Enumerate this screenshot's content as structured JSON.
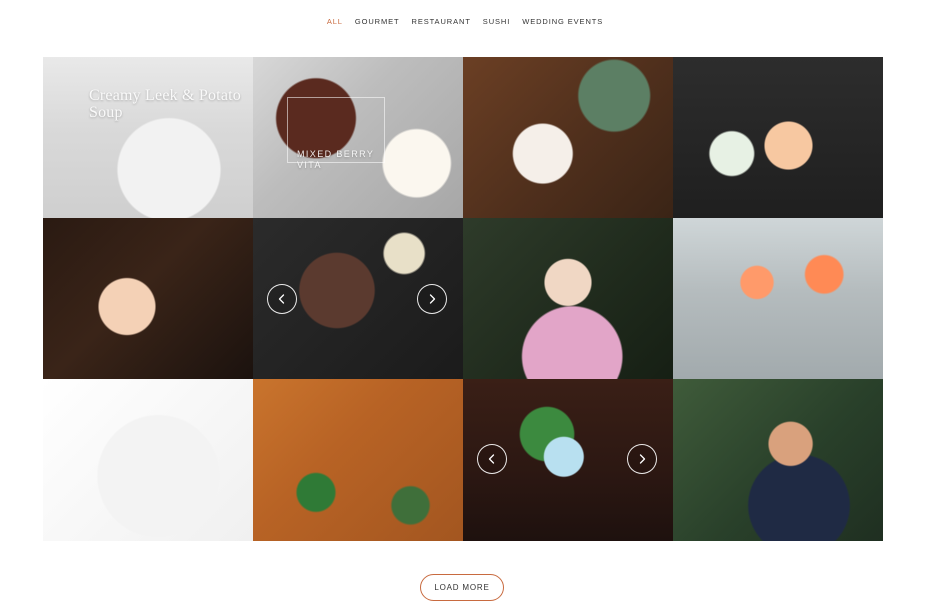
{
  "filters": {
    "items": [
      {
        "label": "ALL",
        "active": true
      },
      {
        "label": "GOURMET",
        "active": false
      },
      {
        "label": "RESTAURANT",
        "active": false
      },
      {
        "label": "SUSHI",
        "active": false
      },
      {
        "label": "WEDDING EVENTS",
        "active": false
      }
    ]
  },
  "gallery": {
    "tiles": [
      {
        "caption": "Creamy Leek & Potato Soup"
      },
      {
        "caption": "MIXED BERRY\nVITA"
      },
      {},
      {},
      {},
      {},
      {},
      {},
      {},
      {},
      {},
      {}
    ]
  },
  "controls": {
    "load_more_label": "LOAD MORE"
  },
  "theme": {
    "accent": "#c86a3f"
  }
}
